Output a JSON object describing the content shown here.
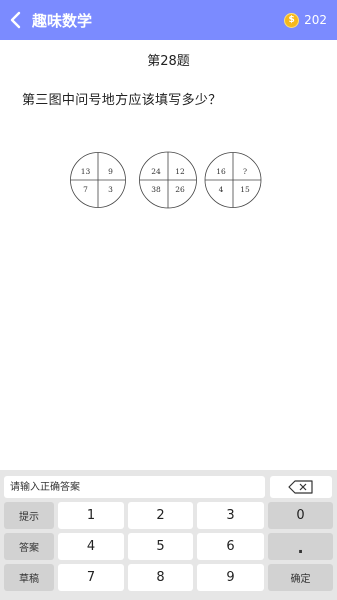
{
  "header": {
    "title": "趣味数学",
    "coin_symbol": "$",
    "coin_count": "202",
    "bg_color": "#7b8bff"
  },
  "question": {
    "number": "第28题",
    "text": "第三图中问号地方应该填写多少？",
    "circles": [
      {
        "cells": [
          "13",
          "9",
          "7",
          "3"
        ]
      },
      {
        "cells": [
          "24",
          "12",
          "38",
          "26"
        ]
      },
      {
        "cells": [
          "16",
          "?",
          "4",
          "15"
        ]
      }
    ]
  },
  "keyboard": {
    "input_placeholder": "请输入正确答案",
    "input_value": "",
    "backspace_icon": "backspace-icon",
    "hint_label": "提示",
    "answer_label": "答案",
    "draft_label": "草稿",
    "confirm_label": "确定",
    "digits": [
      "1",
      "2",
      "3",
      "0",
      "4",
      "5",
      "6",
      ".",
      "7",
      "8",
      "9"
    ]
  }
}
